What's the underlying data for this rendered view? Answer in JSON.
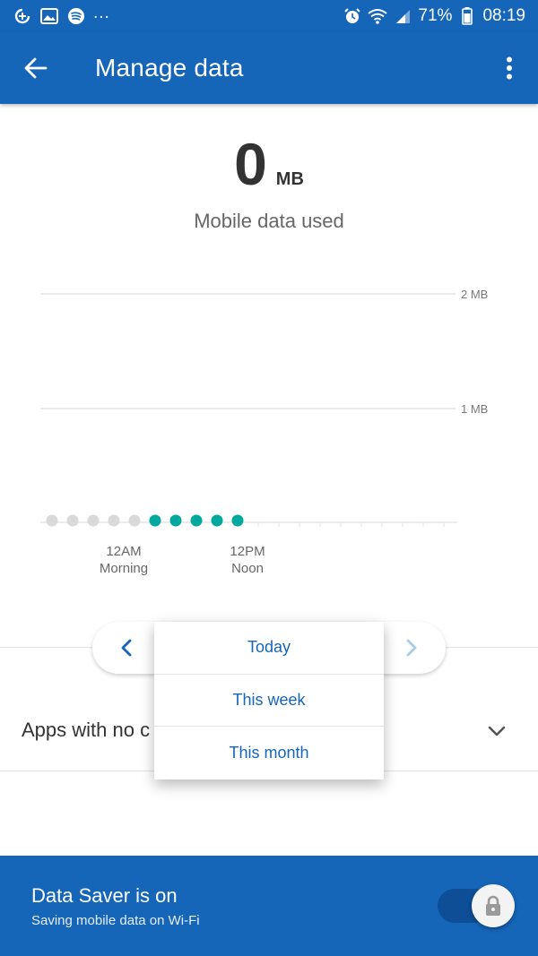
{
  "status_bar": {
    "left_icons": [
      "data-saver-icon",
      "image-icon",
      "spotify-icon"
    ],
    "overflow": "...",
    "right_icons": [
      "alarm-icon",
      "wifi-icon",
      "signal-icon"
    ],
    "battery_percent": "71%",
    "time": "08:19"
  },
  "app_bar": {
    "title": "Manage data",
    "back_icon": "arrow-left-icon",
    "menu_icon": "more-vert-icon"
  },
  "usage": {
    "amount": "0",
    "unit": "MB",
    "label": "Mobile data used"
  },
  "chart_data": {
    "type": "scatter",
    "y_ticks": [
      "2 MB",
      "1 MB"
    ],
    "x_labels": [
      {
        "time": "12AM",
        "label": "Morning"
      },
      {
        "time": "12PM",
        "label": "Noon"
      }
    ],
    "slots": 20,
    "points": [
      {
        "slot": 0,
        "value": 0,
        "state": "past"
      },
      {
        "slot": 1,
        "value": 0,
        "state": "past"
      },
      {
        "slot": 2,
        "value": 0,
        "state": "past"
      },
      {
        "slot": 3,
        "value": 0,
        "state": "past"
      },
      {
        "slot": 4,
        "value": 0,
        "state": "past"
      },
      {
        "slot": 5,
        "value": 0,
        "state": "active"
      },
      {
        "slot": 6,
        "value": 0,
        "state": "active"
      },
      {
        "slot": 7,
        "value": 0,
        "state": "active"
      },
      {
        "slot": 8,
        "value": 0,
        "state": "active"
      },
      {
        "slot": 9,
        "value": 0,
        "state": "active"
      }
    ],
    "colors": {
      "active": "#00a99d",
      "past": "#d9d9d9",
      "grid": "#e6e6e6"
    },
    "ylim": [
      0,
      2
    ]
  },
  "range_selector": {
    "prev_icon": "chevron-left-icon",
    "next_icon": "chevron-right-icon",
    "options": [
      "Today",
      "This week",
      "This month"
    ]
  },
  "apps_section": {
    "label": "Apps with no c",
    "chevron_icon": "chevron-down-icon"
  },
  "data_saver": {
    "title": "Data Saver is on",
    "subtitle": "Saving mobile data on Wi-Fi",
    "toggle_on": true,
    "lock_icon": "lock-icon"
  },
  "colors": {
    "primary": "#1565b8",
    "accent": "#00a99d"
  }
}
